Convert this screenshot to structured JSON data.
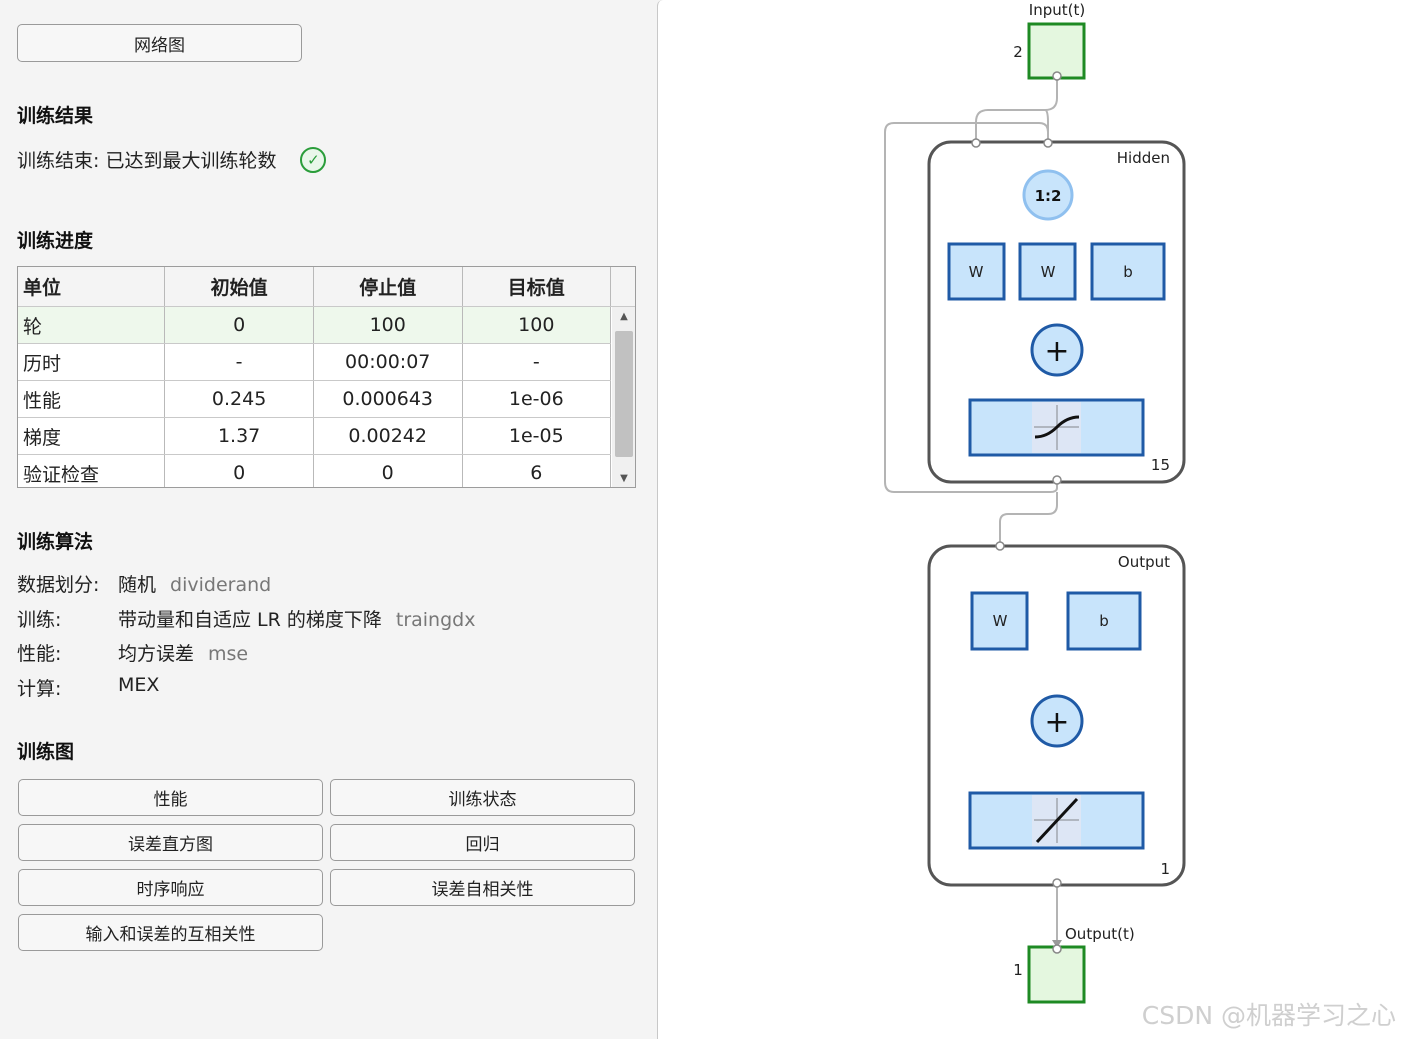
{
  "left": {
    "network_button": "网络图",
    "results_heading": "训练结果",
    "results_status": "训练结束: 已达到最大训练轮数",
    "progress_heading": "训练进度",
    "table": {
      "headers": [
        "单位",
        "初始值",
        "停止值",
        "目标值"
      ],
      "rows": [
        [
          "轮",
          "0",
          "100",
          "100"
        ],
        [
          "历时",
          "-",
          "00:00:07",
          "-"
        ],
        [
          "性能",
          "0.245",
          "0.000643",
          "1e-06"
        ],
        [
          "梯度",
          "1.37",
          "0.00242",
          "1e-05"
        ],
        [
          "验证检查",
          "0",
          "0",
          "6"
        ]
      ]
    },
    "algo_heading": "训练算法",
    "algo": [
      {
        "key": "数据划分:",
        "value": "随机",
        "fn": "dividerand"
      },
      {
        "key": "训练:",
        "value": "带动量和自适应 LR 的梯度下降",
        "fn": "traingdx"
      },
      {
        "key": "性能:",
        "value": "均方误差",
        "fn": "mse"
      },
      {
        "key": "计算:",
        "value": "MEX",
        "fn": ""
      }
    ],
    "plots_heading": "训练图",
    "plot_buttons": [
      "性能",
      "训练状态",
      "误差直方图",
      "回归",
      "时序响应",
      "误差自相关性",
      "输入和误差的互相关性"
    ]
  },
  "diagram": {
    "input_label": "Input(t)",
    "input_size": "2",
    "hidden_label": "Hidden",
    "hidden_size": "15",
    "delay_label": "1:2",
    "hidden_w1": "W",
    "hidden_w2": "W",
    "hidden_b": "b",
    "output_label": "Output",
    "output_size": "1",
    "output_w": "W",
    "output_b": "b",
    "output_t_label": "Output(t)",
    "output_t_size": "1",
    "plus": "+"
  },
  "watermark": "CSDN @机器学习之心",
  "colors": {
    "io_fill": "#e4f7df",
    "io_border": "#1e8a23",
    "block_fill": "#c8e4fb",
    "block_border": "#1f5aa6",
    "layer_border": "#555555",
    "wire": "#b4b4b4"
  }
}
